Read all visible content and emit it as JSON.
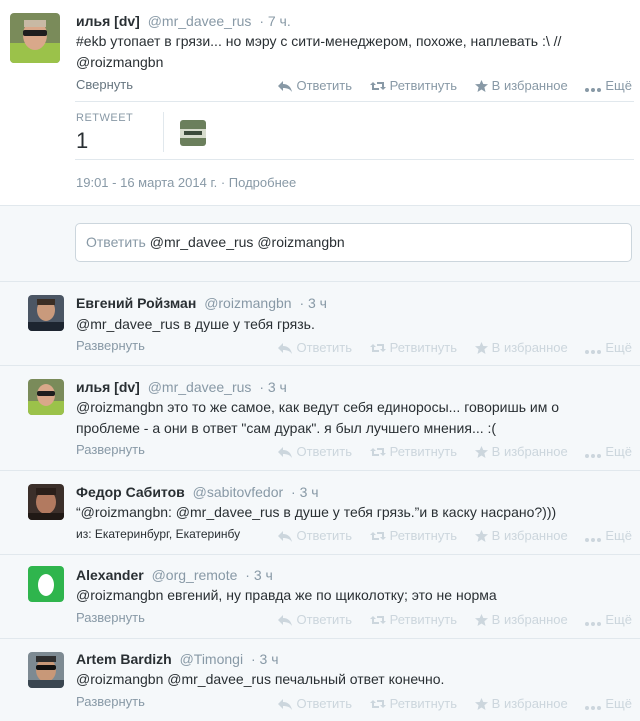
{
  "main_tweet": {
    "name": "илья [dv]",
    "handle": "@mr_davee_rus",
    "time": "· 7 ч.",
    "text_line1": "#ekb утопает в грязи... но мэру с сити-менеджером, похоже, наплевать :\\ //",
    "text_line2": "@roizmangbn",
    "collapse_label": "Свернуть",
    "actions": {
      "reply": "Ответить",
      "retweet": "Ретвитнуть",
      "favorite": "В избранное",
      "more": "Ещё"
    },
    "stats": {
      "label": "RETWEET",
      "value": "1"
    },
    "timestamp": "19:01 - 16 марта 2014 г.",
    "details_link": "Подробнее"
  },
  "reply_box": {
    "placeholder": "Ответить",
    "mentions": "@mr_davee_rus @roizmangbn"
  },
  "replies": [
    {
      "name": "Евгений Ройзман",
      "handle": "@roizmangbn",
      "time": "· 3 ч",
      "lines": [
        "@mr_davee_rus в душе у тебя грязь."
      ],
      "expand": "Развернуть",
      "actions": {
        "reply": "Ответить",
        "retweet": "Ретвитнуть",
        "favorite": "В избранное",
        "more": "Ещё"
      }
    },
    {
      "name": "илья [dv]",
      "handle": "@mr_davee_rus",
      "time": "· 3 ч",
      "lines": [
        "@roizmangbn это то же самое, как ведут себя единоросы... говоришь им о",
        "проблеме - а они в ответ \"сам дурак\". я был лучшего мнения... :("
      ],
      "expand": "Развернуть",
      "actions": {
        "reply": "Ответить",
        "retweet": "Ретвитнуть",
        "favorite": "В избранное",
        "more": "Ещё"
      }
    },
    {
      "name": "Федор Сабитов",
      "handle": "@sabitovfedor",
      "time": "· 3 ч",
      "lines": [
        "“@roizmangbn: @mr_davee_rus в душе у тебя грязь.”и в каску насрано?)))"
      ],
      "location": "из: Екатеринбург, Екатеринбу",
      "expand": "",
      "actions": {
        "reply": "Ответить",
        "retweet": "Ретвитнуть",
        "favorite": "В избранное",
        "more": "Ещё"
      }
    },
    {
      "name": "Alexander",
      "handle": "@org_remote",
      "time": "· 3 ч",
      "lines": [
        "@roizmangbn евгений, ну правда же по щиколотку; это не норма"
      ],
      "expand": "Развернуть",
      "actions": {
        "reply": "Ответить",
        "retweet": "Ретвитнуть",
        "favorite": "В избранное",
        "more": "Ещё"
      }
    },
    {
      "name": "Artem Bardizh",
      "handle": "@Timongi",
      "time": "· 3 ч",
      "lines": [
        "@roizmangbn @mr_davee_rus печальный ответ конечно."
      ],
      "expand": "Развернуть",
      "actions": {
        "reply": "Ответить",
        "retweet": "Ретвитнуть",
        "favorite": "В избранное",
        "more": "Ещё"
      }
    }
  ]
}
